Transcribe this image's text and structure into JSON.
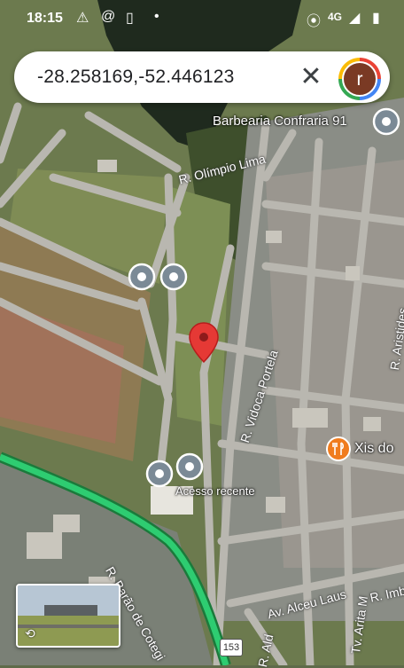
{
  "status_bar": {
    "time": "18:15",
    "network": "4G",
    "icons": [
      "alert-icon",
      "threads-icon",
      "phone-app-icon",
      "dot-icon",
      "location-icon",
      "signal-icon",
      "battery-icon"
    ]
  },
  "search": {
    "query": "-28.258169,-52.446123",
    "clear_icon": "close-icon",
    "avatar_letter": "r"
  },
  "places": {
    "barbearia": "Barbearia Confraria 91",
    "xis": "Xis do",
    "acesso": "Acesso recente"
  },
  "roads": {
    "olimpio": "R. Olímpio Lima",
    "vidoca": "R. Vidoca Portela",
    "aristides": "R. Aristides",
    "alceu": "Av. Alceu Laus",
    "arita": "Tv. Arita M",
    "barao": "R. Barão de Cotegi",
    "ald": "R. Ald",
    "imb": "R. Imb"
  },
  "highway_shield": "153",
  "colors": {
    "pin": "#e53935",
    "poi": "#7b8a96",
    "highway": "#2ecc71",
    "restaurant": "#f07c1e"
  }
}
